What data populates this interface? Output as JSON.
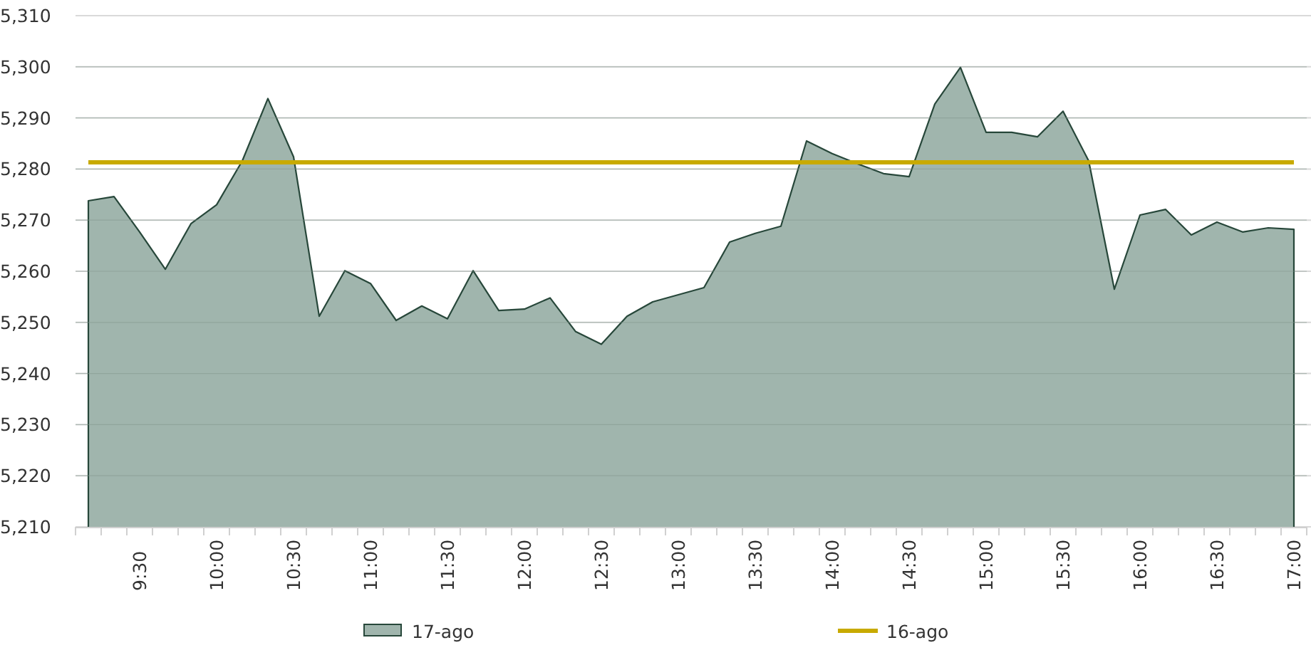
{
  "chart_data": {
    "type": "area",
    "grid": true,
    "legend": true,
    "ylim": [
      5210,
      5310
    ],
    "yticks": [
      {
        "value": 5310,
        "label": "5,310"
      },
      {
        "value": 5300,
        "label": "5,300"
      },
      {
        "value": 5290,
        "label": "5,290"
      },
      {
        "value": 5280,
        "label": "5,280"
      },
      {
        "value": 5270,
        "label": "5,270"
      },
      {
        "value": 5260,
        "label": "5,260"
      },
      {
        "value": 5250,
        "label": "5,250"
      },
      {
        "value": 5240,
        "label": "5,240"
      },
      {
        "value": 5230,
        "label": "5,230"
      },
      {
        "value": 5220,
        "label": "5,220"
      },
      {
        "value": 5210,
        "label": "5,210"
      }
    ],
    "categories": [
      null,
      null,
      "9:30",
      null,
      null,
      "10:00",
      null,
      null,
      "10:30",
      null,
      null,
      "11:00",
      null,
      null,
      "11:30",
      null,
      null,
      "12:00",
      null,
      null,
      "12:30",
      null,
      null,
      "13:00",
      null,
      null,
      "13:30",
      null,
      null,
      "14:00",
      null,
      null,
      "14:30",
      null,
      null,
      "15:00",
      null,
      null,
      "15:30",
      null,
      null,
      "16:00",
      null,
      null,
      "16:30",
      null,
      null,
      "17:00"
    ],
    "series": [
      {
        "name": "17-ago",
        "color": "#a0b5ad",
        "values": [
          5273.8,
          5274.6,
          5267.7,
          5260.4,
          5269.3,
          5273,
          5281.6,
          5293.8,
          5282.4,
          5251.2,
          5260.1,
          5257.6,
          5250.4,
          5253.2,
          5250.7,
          5260.1,
          5252.3,
          5252.6,
          5254.8,
          5248.2,
          5245.7,
          5251.2,
          5254,
          5255.4,
          5256.8,
          5265.7,
          5267.4,
          5268.8,
          5285.5,
          5283,
          5281,
          5279.1,
          5278.5,
          5292.7,
          5299.9,
          5287.2,
          5287.2,
          5286.3,
          5291.3,
          5281.6,
          5256.5,
          5271,
          5272.1,
          5267.1,
          5269.6,
          5267.7,
          5268.5,
          5268.2
        ]
      },
      {
        "name": "16-ago",
        "type": "line",
        "color": "#c8aa00",
        "values": [
          5281.3,
          5281.3,
          5281.3,
          5281.3,
          5281.3,
          5281.3,
          5281.3,
          5281.3,
          5281.3,
          5281.3,
          5281.3,
          5281.3,
          5281.3,
          5281.3,
          5281.3,
          5281.3,
          5281.3,
          5281.3,
          5281.3,
          5281.3,
          5281.3,
          5281.3,
          5281.3,
          5281.3,
          5281.3,
          5281.3,
          5281.3,
          5281.3,
          5281.3,
          5281.3,
          5281.3,
          5281.3,
          5281.3,
          5281.3,
          5281.3,
          5281.3,
          5281.3,
          5281.3,
          5281.3,
          5281.3,
          5281.3,
          5281.3,
          5281.3,
          5281.3,
          5281.3,
          5281.3,
          5281.3,
          5281.3
        ]
      }
    ]
  }
}
